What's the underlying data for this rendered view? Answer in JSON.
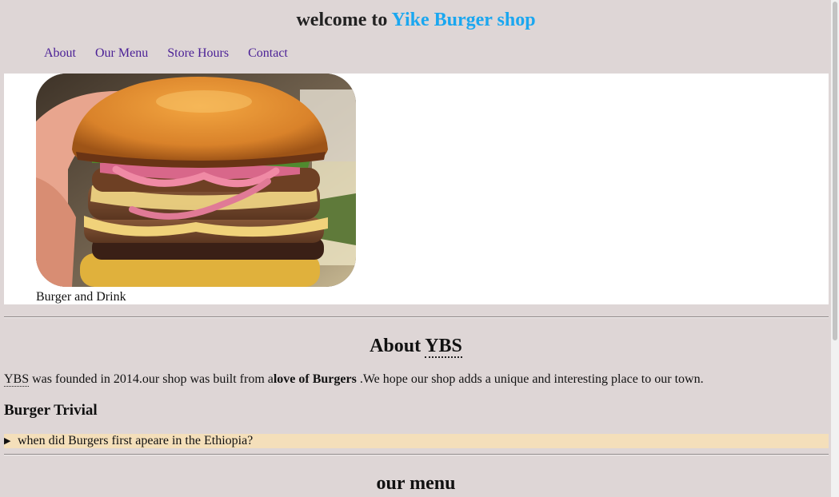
{
  "header": {
    "title_prefix": "welcome to ",
    "title_brand": "Yike Burger shop",
    "brand_color": "#1aa7f0"
  },
  "nav": {
    "items": [
      {
        "label": "About"
      },
      {
        "label": "Our Menu"
      },
      {
        "label": "Store Hours"
      },
      {
        "label": "Contact"
      }
    ],
    "link_color": "#4b2196"
  },
  "hero": {
    "image_subject": "burger-photo",
    "caption": "Burger and Drink"
  },
  "about": {
    "heading_prefix": "About ",
    "heading_abbr": "YBS",
    "text_abbr": "YBS",
    "text_part1": " was founded in 2014.our shop was built from a",
    "text_bold": "love of Burgers",
    "text_part2": " .We hope our shop adds a unique and interesting place to our town."
  },
  "trivia": {
    "heading": "Burger Trivial",
    "question": "when did Burgers first apeare in the Ethiopia?",
    "marker": "▶",
    "row_color": "#f4dfba"
  },
  "menu": {
    "heading": "our menu"
  },
  "colors": {
    "page_background": "#ded6d6",
    "hero_background": "#ffffff"
  }
}
